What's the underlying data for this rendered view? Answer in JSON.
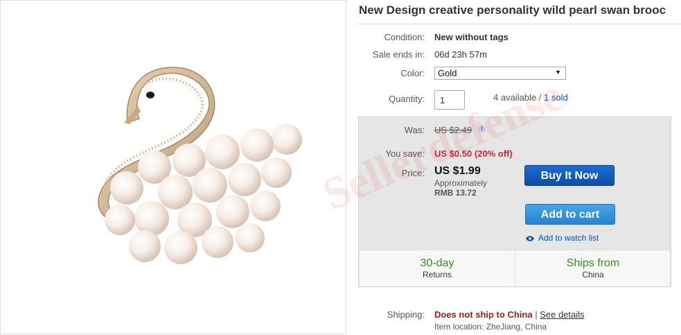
{
  "listing": {
    "title": "New Design creative personality wild pearl swan brooc",
    "condition_label": "Condition:",
    "condition_value": "New without tags",
    "sale_ends_label": "Sale ends in:",
    "sale_ends_value": "06d 23h 57m",
    "color_label": "Color:",
    "color_selected": "Gold",
    "quantity_label": "Quantity:",
    "quantity_value": "1",
    "available_text": "4 available /",
    "sold_text": "1 sold"
  },
  "pricing": {
    "was_label": "Was:",
    "was_value": "US $2.49",
    "save_label": "You save:",
    "save_value": "US $0.50 (20% off)",
    "price_label": "Price:",
    "price_value": "US $1.99",
    "approx_label": "Approximately",
    "approx_value": "RMB 13.72"
  },
  "actions": {
    "buy_label": "Buy It Now",
    "cart_label": "Add to cart",
    "watch_label": "Add to watch list"
  },
  "tiles": [
    {
      "big": "30-day",
      "small": "Returns"
    },
    {
      "big": "Ships from",
      "small": "China"
    }
  ],
  "shipping": {
    "label": "Shipping:",
    "value": "Does not ship to China",
    "separator": "|",
    "details": "See details",
    "location": "Item location:  ZheJiang, China"
  },
  "watermark": "Sellerdefense",
  "colors": {
    "buy_button": "#0f4ea6",
    "cart_button": "#2a8ad8",
    "link": "#0654ba",
    "savings": "#dd1e31",
    "tile_green": "#3a8b1f",
    "panel_bg": "#e6e6e6"
  }
}
